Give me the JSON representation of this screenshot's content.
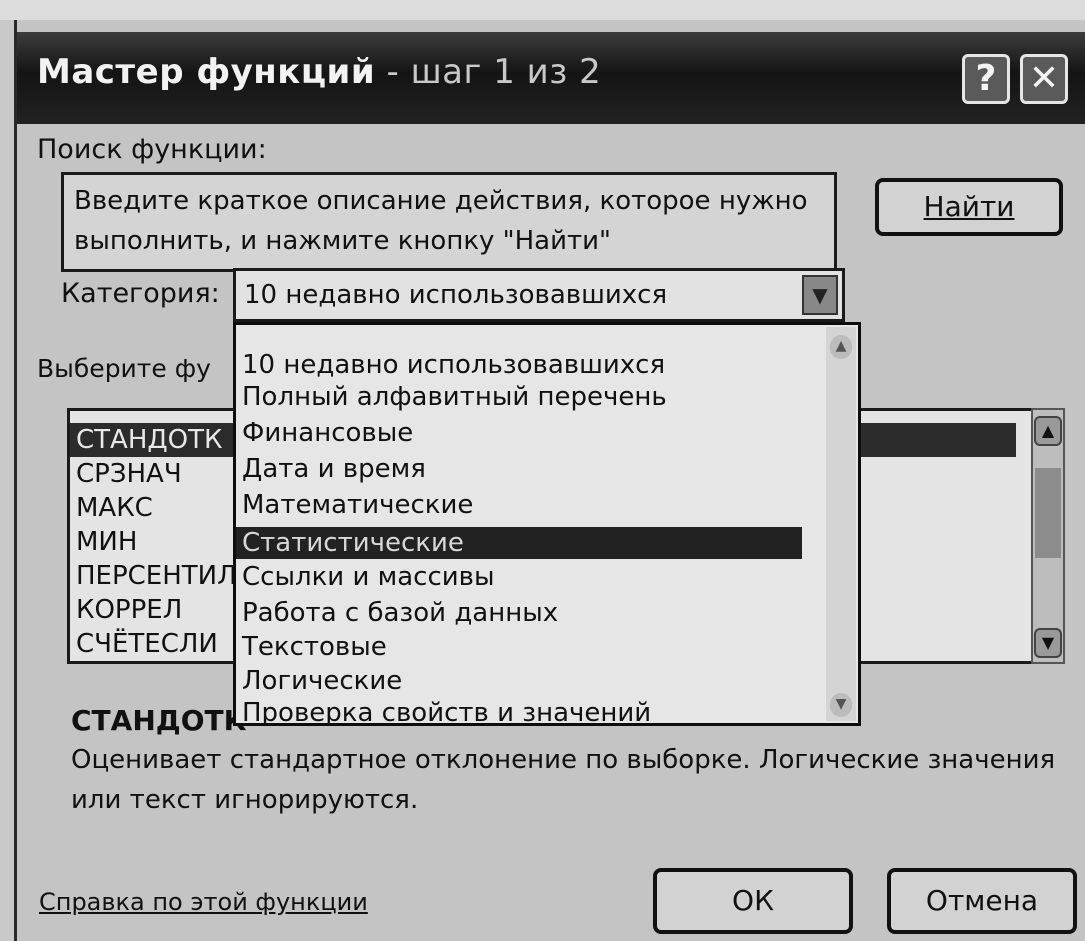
{
  "window": {
    "title_main": "Мастер функций",
    "title_sub": " - шаг 1 из 2",
    "help_glyph": "?",
    "close_glyph": "✕"
  },
  "search": {
    "label": "Поиск функции:",
    "text_line1": "Введите краткое описание действия, которое нужно",
    "text_line2": "выполнить, и нажмите кнопку \"Найти\"",
    "find_button": "Найти"
  },
  "category": {
    "label": "Категория:",
    "selected": "10 недавно использовавшихся",
    "options": [
      "10 недавно использовавшихся",
      "Полный алфавитный перечень",
      "Финансовые",
      "Дата и время",
      "Математические",
      "Статистические",
      "Ссылки и массивы",
      "Работа с базой данных",
      "Текстовые",
      "Логические",
      "Проверка свойств и значений"
    ],
    "highlighted_index": 5
  },
  "functions": {
    "label": "Выберите фу",
    "items": [
      "СТАНДОТК",
      "СРЗНАЧ",
      "МАКС",
      "МИН",
      "ПЕРСЕНТИЛ",
      "КОРРЕЛ",
      "СЧЁТЕСЛИ"
    ],
    "selected_index": 0
  },
  "details": {
    "name": "СТАНДОТК",
    "description": "Оценивает стандартное отклонение по выборке. Логические значения или текст игнорируются."
  },
  "footer": {
    "help_link": "Справка по этой функции",
    "ok_button": "ОК",
    "cancel_button": "Отмена"
  }
}
